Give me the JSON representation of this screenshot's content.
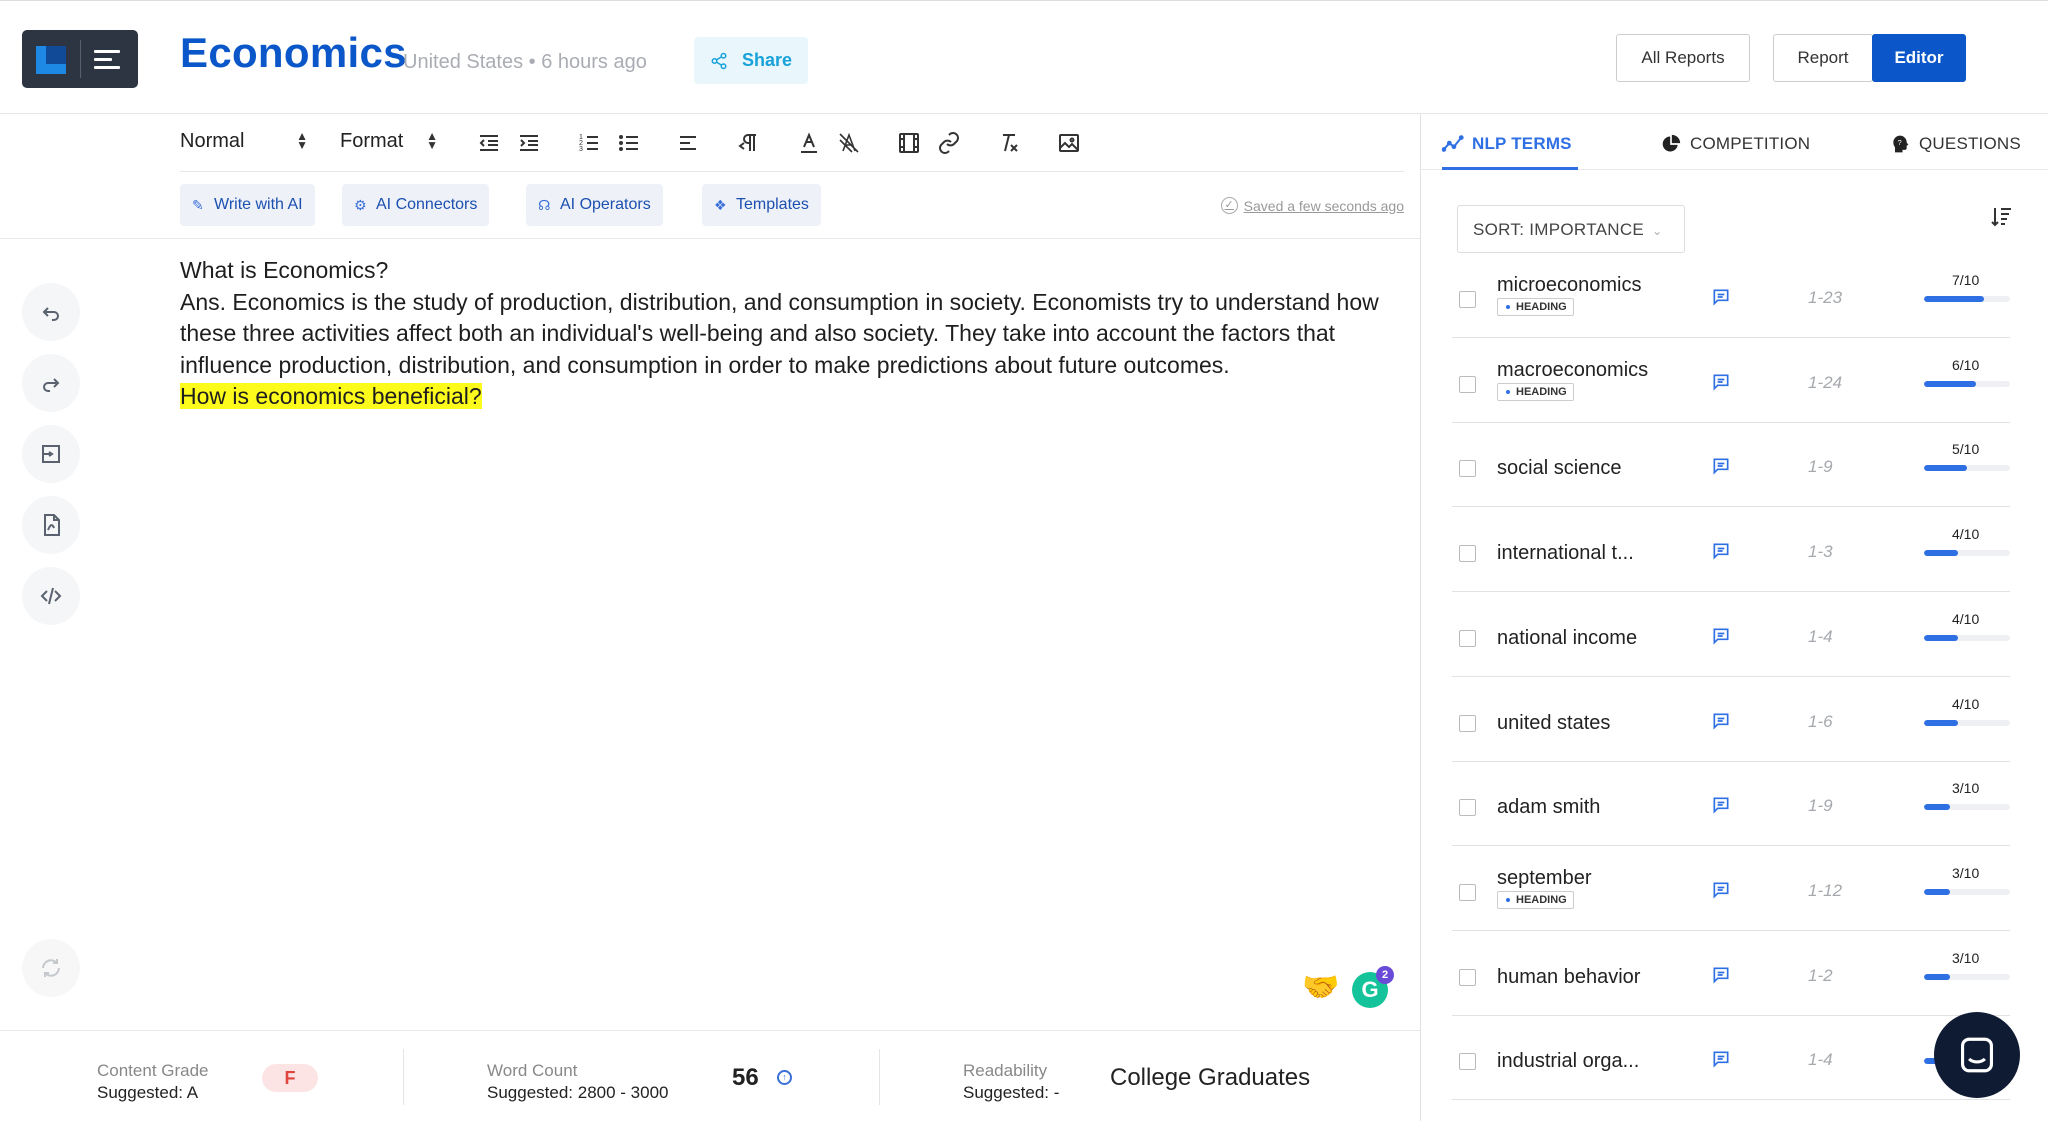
{
  "header": {
    "title": "Economics",
    "location": "United States",
    "time_ago": "6 hours ago",
    "share_label": "Share",
    "all_reports_label": "All Reports",
    "report_label": "Report",
    "editor_label": "Editor",
    "brand_color": "#0b57c9"
  },
  "toolbar": {
    "block_style": "Normal",
    "format_label": "Format",
    "icons": [
      "outdent-icon",
      "indent-icon",
      "ordered-list-icon",
      "bullet-list-icon",
      "align-left-icon",
      "text-direction-icon",
      "font-color-icon",
      "highlight-color-icon",
      "video-icon",
      "link-icon",
      "clear-format-icon",
      "image-icon"
    ]
  },
  "ai_tools": {
    "write_with_ai": "Write with AI",
    "ai_connectors": "AI Connectors",
    "ai_operators": "AI Operators",
    "templates": "Templates",
    "saved_status": "Saved a few seconds ago"
  },
  "content": {
    "line1": "What is Economics?",
    "paragraph": "Ans. Economics is the study of production, distribution, and consumption in society. Economists try to understand how these three activities affect both an individual's well-being and also society. They take into account the factors that influence production, distribution, and consumption in order to make predictions about future outcomes.",
    "highlighted": "How is economics beneficial?",
    "highlight_color": "#fdfb1c"
  },
  "left_rail": [
    "undo-icon",
    "redo-icon",
    "outline-icon",
    "pdf-icon",
    "code-icon",
    "sync-icon"
  ],
  "grammarly_badge": "2",
  "stats": {
    "grade_label": "Content Grade",
    "grade_suggested": "Suggested: A",
    "grade_value": "F",
    "word_label": "Word Count",
    "word_suggested": "Suggested: 2800 - 3000",
    "word_value": "56",
    "readability_label": "Readability",
    "readability_suggested": "Suggested: -",
    "readability_value": "College Graduates"
  },
  "right_panel": {
    "tabs": [
      "NLP TERMS",
      "COMPETITION",
      "QUESTIONS"
    ],
    "active_tab": "NLP TERMS",
    "sort_label": "SORT: IMPORTANCE",
    "heading_tag": "HEADING",
    "terms": [
      {
        "name": "microeconomics",
        "heading": true,
        "range": "1-23",
        "score": "7/10",
        "importance": 0.7
      },
      {
        "name": "macroeconomics",
        "heading": true,
        "range": "1-24",
        "score": "6/10",
        "importance": 0.6
      },
      {
        "name": "social science",
        "heading": false,
        "range": "1-9",
        "score": "5/10",
        "importance": 0.5
      },
      {
        "name": "international t...",
        "heading": false,
        "range": "1-3",
        "score": "4/10",
        "importance": 0.4
      },
      {
        "name": "national income",
        "heading": false,
        "range": "1-4",
        "score": "4/10",
        "importance": 0.4
      },
      {
        "name": "united states",
        "heading": false,
        "range": "1-6",
        "score": "4/10",
        "importance": 0.4
      },
      {
        "name": "adam smith",
        "heading": false,
        "range": "1-9",
        "score": "3/10",
        "importance": 0.3
      },
      {
        "name": "september",
        "heading": true,
        "range": "1-12",
        "score": "3/10",
        "importance": 0.3
      },
      {
        "name": "human behavior",
        "heading": false,
        "range": "1-2",
        "score": "3/10",
        "importance": 0.3
      },
      {
        "name": "industrial orga...",
        "heading": false,
        "range": "1-4",
        "score": "",
        "importance": 0.3
      }
    ]
  }
}
